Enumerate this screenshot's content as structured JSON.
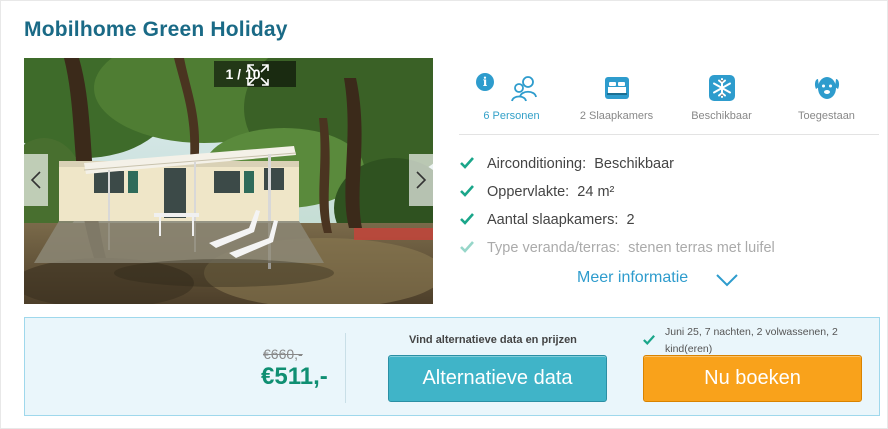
{
  "listing": {
    "title": "Mobilhome Green Holiday"
  },
  "gallery": {
    "counter": "1 / 10",
    "current": 1,
    "total": 10
  },
  "features": [
    {
      "label": "6 Personen",
      "icon": "people-icon",
      "active": true
    },
    {
      "label": "2 Slaapkamers",
      "icon": "bed-icon",
      "active": false
    },
    {
      "label": "Beschikbaar",
      "icon": "snowflake-icon",
      "active": false
    },
    {
      "label": "Toegestaan",
      "icon": "dog-icon",
      "active": false
    }
  ],
  "amenities": [
    {
      "label": "Airconditioning:",
      "value": "Beschikbaar"
    },
    {
      "label": "Oppervlakte:",
      "value": "24 m²"
    },
    {
      "label": "Aantal slaapkamers:",
      "value": "2"
    },
    {
      "label": "Type veranda/terras:",
      "value": "stenen terras met luifel"
    }
  ],
  "more_info": "Meer informatie",
  "booking": {
    "old_price": "€660,-",
    "price": "€511,-",
    "alt_caption": "Vind alternatieve data en prijzen",
    "alt_button": "Alternatieve data",
    "summary": "Juni 25, 7 nachten, 2 volwassenen, 2 kind(eren)",
    "book_button": "Nu boeken"
  },
  "colors": {
    "title": "#1a6a86",
    "accent_blue": "#2e9ccd",
    "check_green": "#1aa68a",
    "price_green": "#0f8f72",
    "alt_button": "#40b4c8",
    "book_button": "#f9a21b",
    "booking_bg": "#eaf6fb"
  }
}
